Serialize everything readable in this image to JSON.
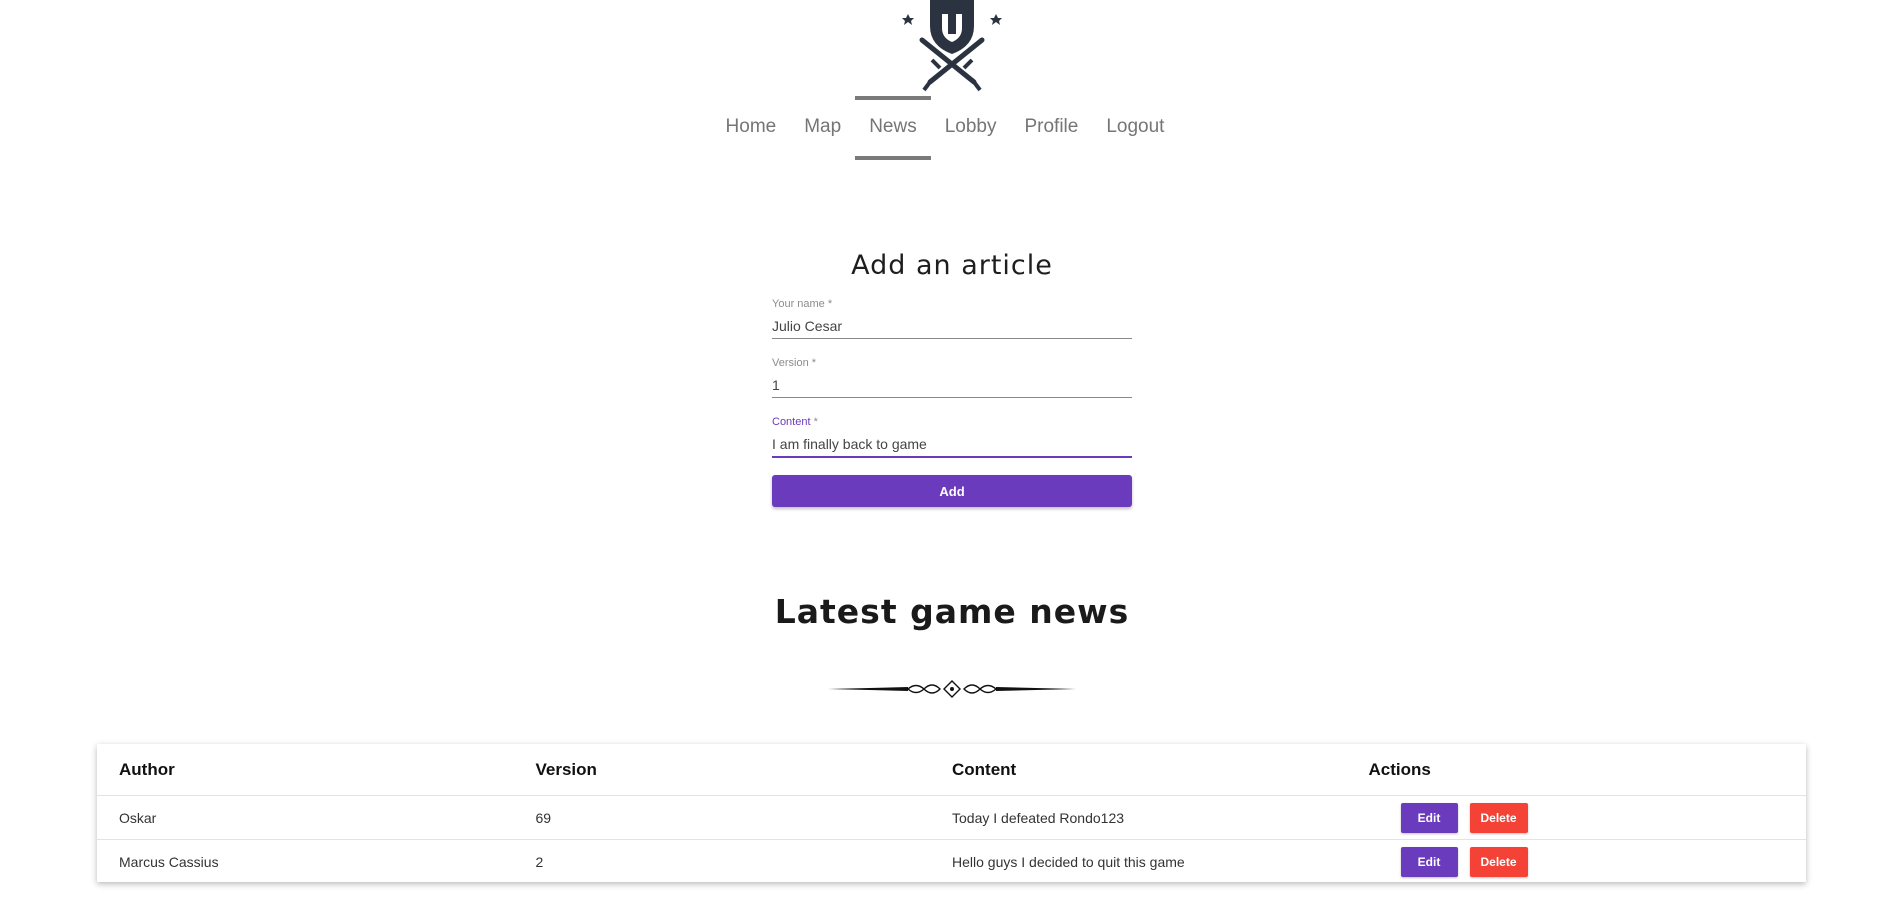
{
  "nav": {
    "items": [
      {
        "label": "Home"
      },
      {
        "label": "Map"
      },
      {
        "label": "News",
        "active": true
      },
      {
        "label": "Lobby"
      },
      {
        "label": "Profile"
      },
      {
        "label": "Logout"
      }
    ]
  },
  "form": {
    "title": "Add an article",
    "fields": [
      {
        "label": "Your name",
        "required_mark": "*",
        "value": "Julio Cesar"
      },
      {
        "label": "Version",
        "required_mark": "*",
        "value": "1"
      },
      {
        "label": "Content",
        "required_mark": "*",
        "value": "I am finally back to game",
        "focused": true
      }
    ],
    "submit_label": "Add"
  },
  "news": {
    "title": "Latest game news",
    "columns": [
      "Author",
      "Version",
      "Content",
      "Actions"
    ],
    "rows": [
      {
        "author": "Oskar",
        "version": "69",
        "content": "Today I defeated Rondo123"
      },
      {
        "author": "Marcus Cassius",
        "version": "2",
        "content": "Hello guys I decided to quit this game"
      }
    ],
    "edit_label": "Edit",
    "delete_label": "Delete"
  },
  "icons": {
    "logo": "spartan-helmet-crossed-swords-logo",
    "divider": "ornamental-divider"
  },
  "colors": {
    "primary": "#6a3bbd",
    "danger": "#f44336",
    "nav_text": "#757575"
  }
}
